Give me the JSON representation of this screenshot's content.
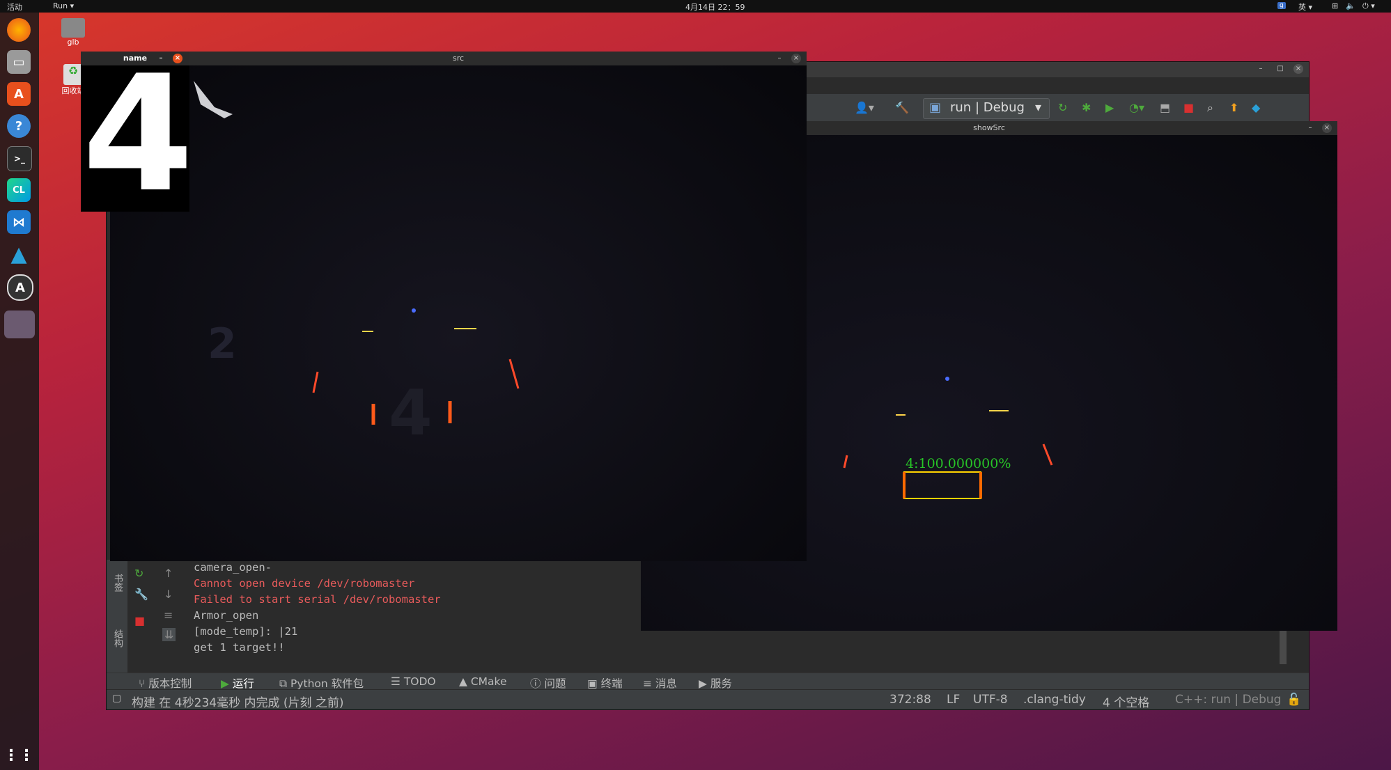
{
  "topbar": {
    "activities": "活动",
    "app_menu": "Run",
    "datetime": "4月14日 22：59",
    "input_method": "英"
  },
  "desktop": {
    "home_folder": "glb",
    "trash": "回收站"
  },
  "ide": {
    "run_config": "run | Debug",
    "console_lines": [
      {
        "text": "camera_open-",
        "error": false
      },
      {
        "text": "Cannot open device /dev/robomaster",
        "error": true
      },
      {
        "text": "Failed to start serial /dev/robomaster",
        "error": true
      },
      {
        "text": "Armor_open",
        "error": false
      },
      {
        "text": "[mode_temp]:    |21",
        "error": false
      },
      {
        "text": "get 1 target!!",
        "error": false
      }
    ],
    "side_labels": {
      "bookmarks": "书签",
      "structure": "结构"
    },
    "bottom_tabs": [
      "版本控制",
      "运行",
      "Python 软件包",
      "TODO",
      "CMake",
      "问题",
      "终端",
      "消息",
      "服务"
    ],
    "status": {
      "message": "构建 在 4秒234毫秒 内完成 (片刻 之前)",
      "position": "372:88",
      "line_ending": "LF",
      "encoding": "UTF-8",
      "linter": ".clang-tidy",
      "indent": "4 个空格",
      "context": "C++: run | Debug"
    }
  },
  "windows": {
    "name_title": "name",
    "name_digit": "4",
    "src_title": "src",
    "showsrc_title": "showSrc",
    "detection_label": "4:100.000000%"
  },
  "colors": {
    "accent_green": "#4eaa3c",
    "error_red": "#e85b5b",
    "detection_green": "#27c427",
    "detection_box": "#ffd300"
  }
}
